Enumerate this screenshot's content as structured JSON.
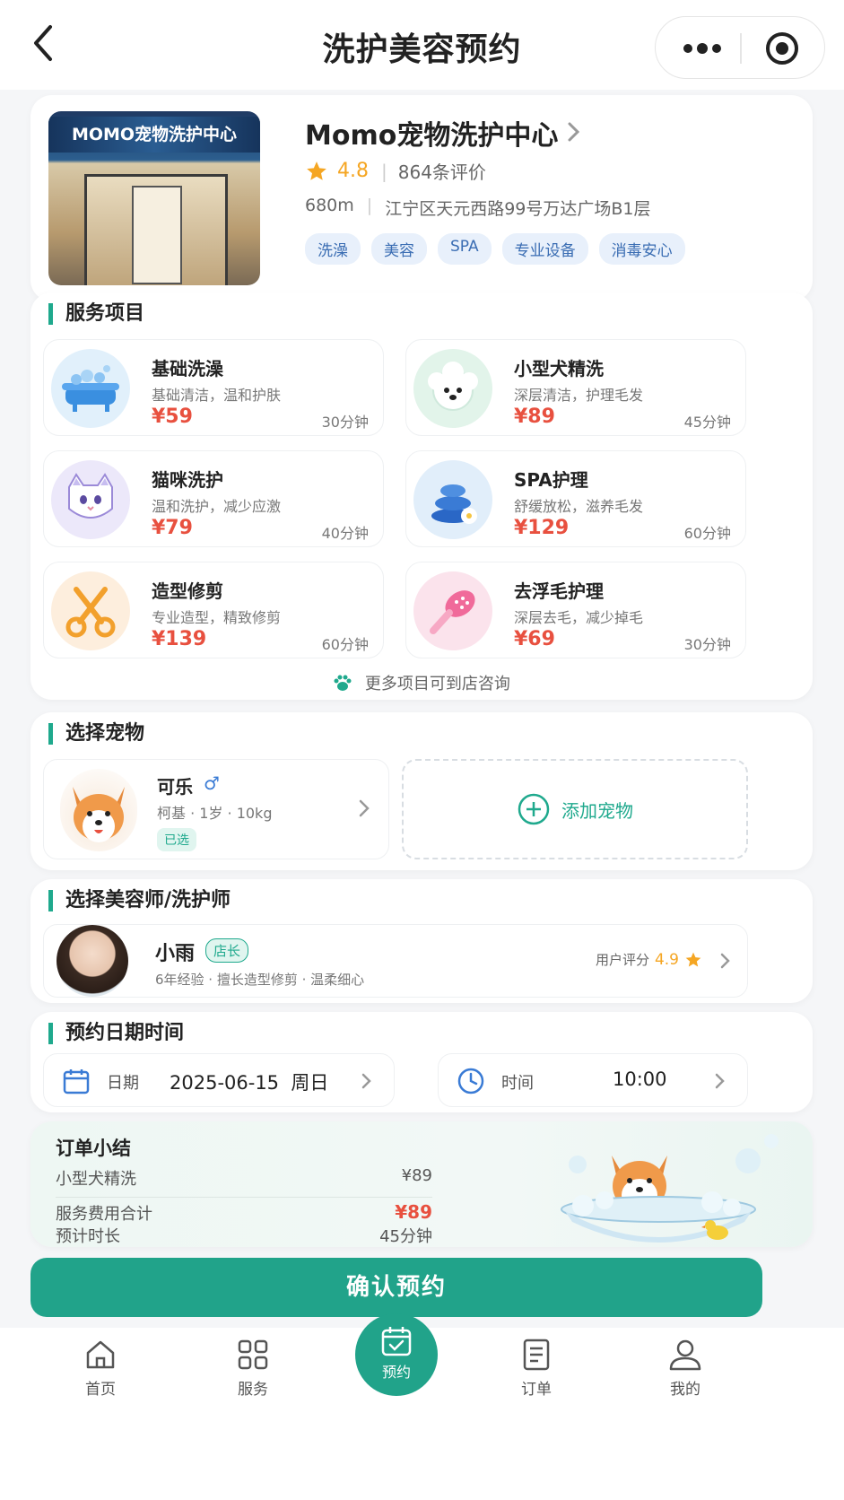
{
  "header": {
    "title": "洗护美容预约"
  },
  "shop": {
    "name": "Momo宠物洗护中心",
    "sign_text": "MOMO宠物洗护中心",
    "rating": "4.8",
    "reviews": "864条评价",
    "distance": "680m",
    "address": "江宁区天元西路99号万达广场B1层",
    "tags": [
      "洗澡",
      "美容",
      "SPA",
      "专业设备",
      "消毒安心"
    ]
  },
  "services": {
    "title": "服务项目",
    "items": [
      {
        "name": "基础洗澡",
        "desc": "基础清洁，温和护肤",
        "price": "¥59",
        "duration": "30分钟",
        "icon": "bathtub-icon"
      },
      {
        "name": "小型犬精洗",
        "desc": "深层清洁，护理毛发",
        "price": "¥89",
        "duration": "45分钟",
        "icon": "poodle-icon"
      },
      {
        "name": "猫咪洗护",
        "desc": "温和洗护，减少应激",
        "price": "¥79",
        "duration": "40分钟",
        "icon": "cat-icon"
      },
      {
        "name": "SPA护理",
        "desc": "舒缓放松，滋养毛发",
        "price": "¥129",
        "duration": "60分钟",
        "icon": "spa-stones-icon"
      },
      {
        "name": "造型修剪",
        "desc": "专业造型，精致修剪",
        "price": "¥139",
        "duration": "60分钟",
        "icon": "scissors-icon"
      },
      {
        "name": "去浮毛护理",
        "desc": "深层去毛，减少掉毛",
        "price": "¥69",
        "duration": "30分钟",
        "icon": "brush-icon"
      }
    ],
    "more_hint": "更多项目可到店咨询"
  },
  "pet": {
    "title": "选择宠物",
    "name": "可乐",
    "gender": "♂",
    "info": "柯基 · 1岁 · 10kg",
    "badge": "已选",
    "add_label": "添加宠物"
  },
  "groomer": {
    "title": "选择美容师/洗护师",
    "name": "小雨",
    "badge": "店长",
    "desc": "6年经验 · 擅长造型修剪 · 温柔细心",
    "score_label": "用户评分",
    "score": "4.9"
  },
  "schedule": {
    "title": "预约日期时间",
    "date_label": "日期",
    "date_value": "2025-06-15  周日",
    "time_label": "时间",
    "time_value": "10:00"
  },
  "summary": {
    "title": "订单小结",
    "item_name": "小型犬精洗",
    "item_price": "¥89",
    "total_label": "服务费用合计",
    "total_value": "¥89",
    "duration_label": "预计时长",
    "duration_value": "45分钟"
  },
  "confirm_label": "确认预约",
  "tabs": [
    "首页",
    "服务",
    "预约",
    "订单",
    "我的"
  ],
  "colors": {
    "accent": "#21a38a",
    "price": "#e8503f",
    "star": "#f5a623"
  }
}
